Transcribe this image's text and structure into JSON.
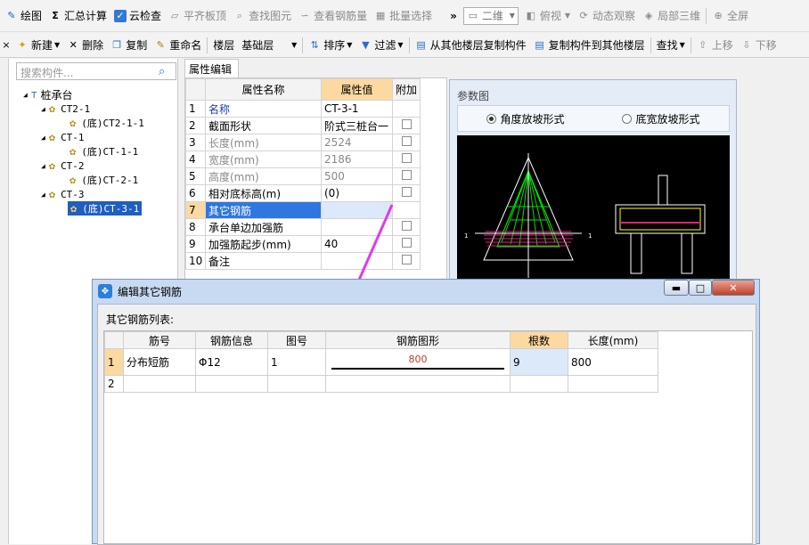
{
  "toolbar1": [
    {
      "label": "绘图",
      "icon": "draw-icon",
      "disabled": false
    },
    {
      "label": "汇总计算",
      "icon": "sigma-icon",
      "disabled": false
    },
    {
      "label": "云检查",
      "icon": "cloud-check-icon",
      "disabled": false
    },
    {
      "label": "平齐板顶",
      "icon": "align-top-icon",
      "disabled": true
    },
    {
      "label": "查找图元",
      "icon": "find-element-icon",
      "disabled": true
    },
    {
      "label": "查看钢筋量",
      "icon": "view-rebar-icon",
      "disabled": true
    },
    {
      "label": "批量选择",
      "icon": "batch-select-icon",
      "disabled": true
    }
  ],
  "toolbar1_right": {
    "more": "»",
    "view_mode": "二维",
    "top_view": "俯视",
    "dynamic_view": "动态观察",
    "local_3d": "局部三维",
    "fullscreen": "全屏"
  },
  "toolbar2": {
    "new": "新建",
    "delete": "删除",
    "copy": "复制",
    "rename": "重命名",
    "floor_label": "楼层",
    "floor_value": "基础层",
    "sort": "排序",
    "filter": "过滤",
    "copy_from": "从其他楼层复制构件",
    "copy_to": "复制构件到其他楼层",
    "find": "查找",
    "up": "上移",
    "down": "下移"
  },
  "search": {
    "placeholder": "搜索构件..."
  },
  "tree": {
    "root": "桩承台",
    "groups": [
      {
        "name": "CT2-1",
        "child": "(底)CT2-1-1"
      },
      {
        "name": "CT-1",
        "child": "(底)CT-1-1"
      },
      {
        "name": "CT-2",
        "child": "(底)CT-2-1"
      },
      {
        "name": "CT-3",
        "child": "(底)CT-3-1"
      }
    ]
  },
  "attr_tab": "属性编辑",
  "attr_headers": {
    "name": "属性名称",
    "value": "属性值",
    "extra": "附加"
  },
  "attr_rows": [
    {
      "n": "1",
      "name": "名称",
      "value": "CT-3-1",
      "check": false
    },
    {
      "n": "2",
      "name": "截面形状",
      "value": "阶式三桩台一",
      "check": true
    },
    {
      "n": "3",
      "name": "长度(mm)",
      "value": "2524",
      "check": true
    },
    {
      "n": "4",
      "name": "宽度(mm)",
      "value": "2186",
      "check": true
    },
    {
      "n": "5",
      "name": "高度(mm)",
      "value": "500",
      "check": true
    },
    {
      "n": "6",
      "name": "相对底标高(m)",
      "value": "(0)",
      "check": true
    },
    {
      "n": "7",
      "name": "其它钢筋",
      "value": "",
      "check": false
    },
    {
      "n": "8",
      "name": "承台单边加强筋",
      "value": "",
      "check": true
    },
    {
      "n": "9",
      "name": "加强筋起步(mm)",
      "value": "40",
      "check": true
    },
    {
      "n": "10",
      "name": "备注",
      "value": "",
      "check": true
    }
  ],
  "param": {
    "title": "参数图",
    "radio1": "角度放坡形式",
    "radio2": "底宽放坡形式"
  },
  "dialog": {
    "title": "编辑其它钢筋",
    "list_label": "其它钢筋列表:",
    "headers": [
      "筋号",
      "钢筋信息",
      "图号",
      "钢筋图形",
      "根数",
      "长度(mm)"
    ],
    "rows": [
      {
        "n": "1",
        "name": "分布短筋",
        "info": "Φ12",
        "fig": "1",
        "shape": "800",
        "count": "9",
        "length": "800"
      },
      {
        "n": "2",
        "name": "",
        "info": "",
        "fig": "",
        "shape": "",
        "count": "",
        "length": ""
      }
    ]
  },
  "colors": {
    "accent": "#1e5fbf",
    "header_highlight": "#fcd9a0",
    "arrow": "#e03ce6"
  }
}
